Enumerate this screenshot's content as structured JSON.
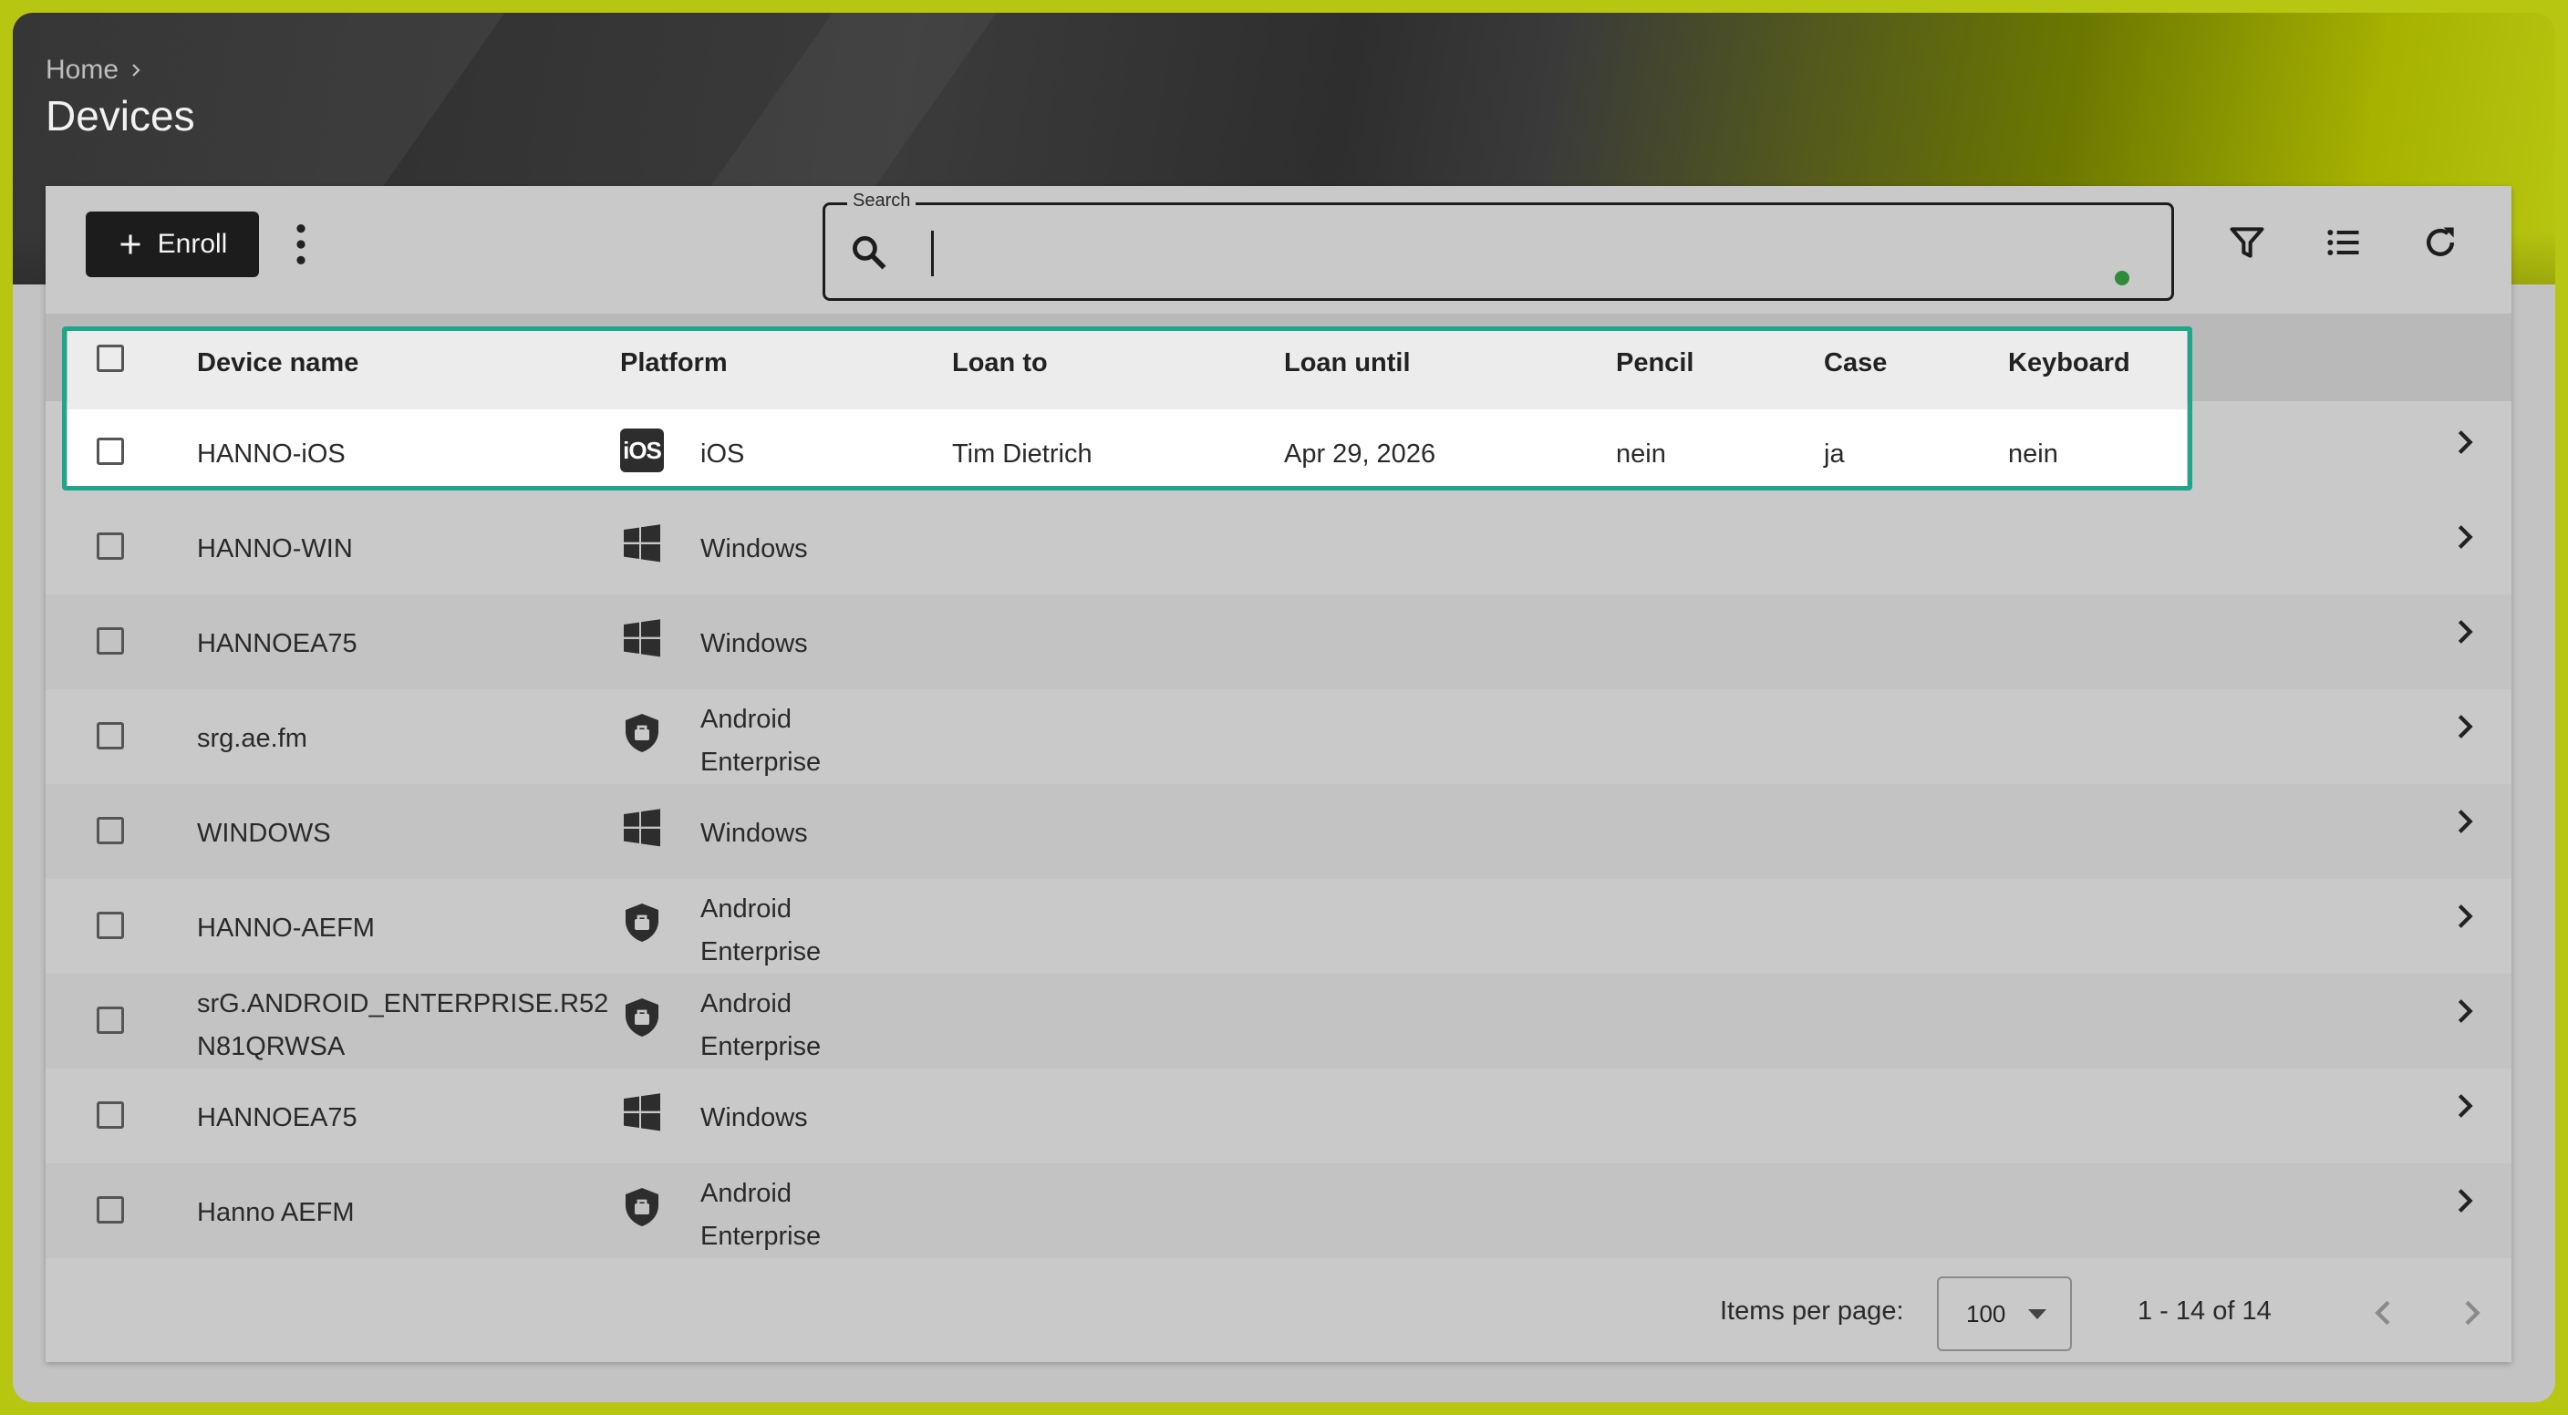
{
  "breadcrumb": {
    "home": "Home"
  },
  "page": {
    "title": "Devices"
  },
  "toolbar": {
    "enroll_label": "Enroll",
    "search_label": "Search",
    "search_value": ""
  },
  "table": {
    "columns": [
      "Device name",
      "Platform",
      "Loan to",
      "Loan until",
      "Pencil",
      "Case",
      "Keyboard"
    ],
    "rows": [
      {
        "name": "HANNO-iOS",
        "platform": "iOS",
        "platform_icon": "ios-icon",
        "platform_line2": "",
        "loan_to": "Tim Dietrich",
        "loan_until": "Apr 29, 2026",
        "pencil": "nein",
        "case": "ja",
        "keyboard": "nein"
      },
      {
        "name": "HANNO-WIN",
        "platform": "Windows",
        "platform_icon": "windows-icon",
        "platform_line2": "",
        "loan_to": "",
        "loan_until": "",
        "pencil": "",
        "case": "",
        "keyboard": ""
      },
      {
        "name": "HANNOEA75",
        "platform": "Windows",
        "platform_icon": "windows-icon",
        "platform_line2": "",
        "loan_to": "",
        "loan_until": "",
        "pencil": "",
        "case": "",
        "keyboard": ""
      },
      {
        "name": "srg.ae.fm",
        "platform": "Android",
        "platform_icon": "android-enterprise-icon",
        "platform_line2": "Enterprise",
        "loan_to": "",
        "loan_until": "",
        "pencil": "",
        "case": "",
        "keyboard": ""
      },
      {
        "name": "WINDOWS",
        "platform": "Windows",
        "platform_icon": "windows-icon",
        "platform_line2": "",
        "loan_to": "",
        "loan_until": "",
        "pencil": "",
        "case": "",
        "keyboard": ""
      },
      {
        "name": "HANNO-AEFM",
        "platform": "Android",
        "platform_icon": "android-enterprise-icon",
        "platform_line2": "Enterprise",
        "loan_to": "",
        "loan_until": "",
        "pencil": "",
        "case": "",
        "keyboard": ""
      },
      {
        "name": "srG.ANDROID_ENTERPRISE.R52",
        "name_line2": "N81QRWSA",
        "platform": "Android",
        "platform_icon": "android-enterprise-icon",
        "platform_line2": "Enterprise",
        "loan_to": "",
        "loan_until": "",
        "pencil": "",
        "case": "",
        "keyboard": ""
      },
      {
        "name": "HANNOEA75",
        "platform": "Windows",
        "platform_icon": "windows-icon",
        "platform_line2": "",
        "loan_to": "",
        "loan_until": "",
        "pencil": "",
        "case": "",
        "keyboard": ""
      },
      {
        "name": "Hanno AEFM",
        "platform": "Android",
        "platform_icon": "android-enterprise-icon",
        "platform_line2": "Enterprise",
        "loan_to": "",
        "loan_until": "",
        "pencil": "",
        "case": "",
        "keyboard": ""
      }
    ]
  },
  "paginator": {
    "items_per_page_label": "Items per page:",
    "items_per_page": "100",
    "range": "1 - 14 of 14"
  },
  "colors": {
    "highlight": "#1fa58a",
    "brand_green": "#b7c611",
    "status_dot": "#2e8b3a"
  }
}
